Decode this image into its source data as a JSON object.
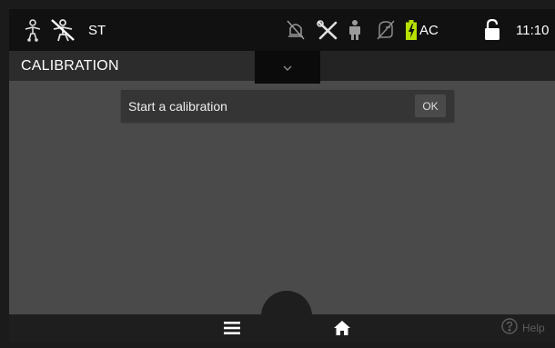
{
  "status_bar": {
    "patient_mode": "ST",
    "power_source": "AC",
    "time": "11:10",
    "icons": [
      "patient-icon",
      "patient-crossed-icon",
      "alarm-off-icon",
      "tools-icon",
      "person-icon",
      "gas-icon",
      "battery-charging-icon",
      "lock-open-icon"
    ],
    "colors": {
      "battery_charge": "#b7e000"
    }
  },
  "title_bar": {
    "title": "CALIBRATION"
  },
  "message": {
    "text": "Start a calibration",
    "ok_label": "OK"
  },
  "bottom_bar": {
    "help_label": "Help"
  }
}
